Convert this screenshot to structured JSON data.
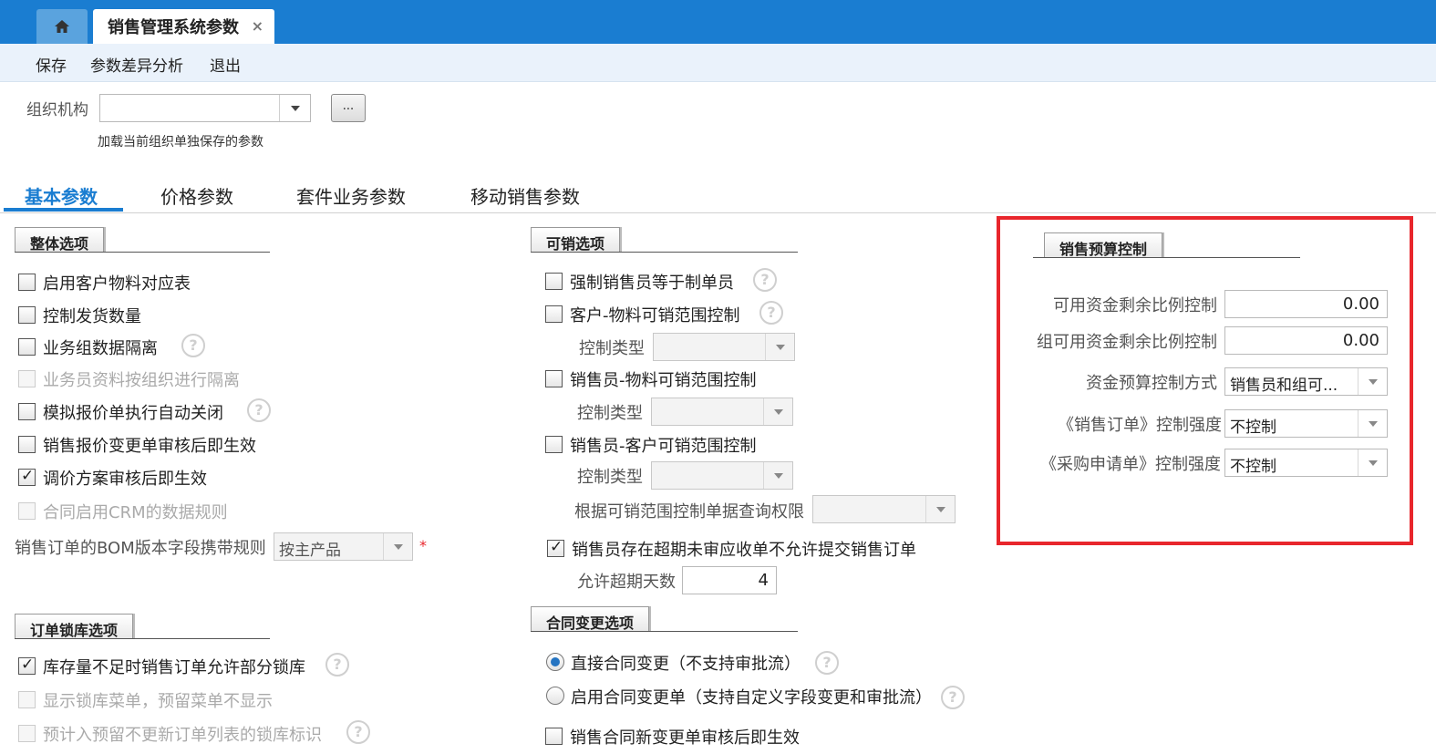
{
  "window": {
    "tab_title": "销售管理系统参数",
    "close_glyph": "×"
  },
  "toolbar": {
    "save": "保存",
    "diff_analysis": "参数差异分析",
    "exit": "退出"
  },
  "org": {
    "label": "组织机构",
    "value": "",
    "browse": "...",
    "hint": "加载当前组织单独保存的参数"
  },
  "tabs": [
    "基本参数",
    "价格参数",
    "套件业务参数",
    "移动销售参数"
  ],
  "overall": {
    "header": "整体选项",
    "items": [
      {
        "label": "启用客户物料对应表",
        "checked": false,
        "disabled": false
      },
      {
        "label": "控制发货数量",
        "checked": false,
        "disabled": false
      },
      {
        "label": "业务组数据隔离",
        "checked": false,
        "disabled": false
      },
      {
        "label": "业务员资料按组织进行隔离",
        "checked": false,
        "disabled": true
      },
      {
        "label": "模拟报价单执行自动关闭",
        "checked": false,
        "disabled": false
      },
      {
        "label": "销售报价变更单审核后即生效",
        "checked": false,
        "disabled": false
      },
      {
        "label": "调价方案审核后即生效",
        "checked": true,
        "disabled": false
      },
      {
        "label": "合同启用CRM的数据规则",
        "checked": false,
        "disabled": true
      }
    ],
    "bom_label": "销售订单的BOM版本字段携带规则",
    "bom_value": "按主产品",
    "required_mark": "*"
  },
  "lock": {
    "header": "订单锁库选项",
    "items": [
      {
        "label": "库存量不足时销售订单允许部分锁库",
        "checked": true,
        "disabled": false
      },
      {
        "label": "显示锁库菜单，预留菜单不显示",
        "checked": false,
        "disabled": true
      },
      {
        "label": "预计入预留不更新订单列表的锁库标识",
        "checked": false,
        "disabled": true
      }
    ]
  },
  "salable": {
    "header": "可销选项",
    "items": [
      {
        "label": "强制销售员等于制单员",
        "checked": false
      },
      {
        "label": "客户-物料可销范围控制",
        "checked": false
      },
      {
        "label": "销售员-物料可销范围控制",
        "checked": false
      },
      {
        "label": "销售员-客户可销范围控制",
        "checked": false
      }
    ],
    "control_type_label": "控制类型",
    "query_perm_label": "根据可销范围控制单据查询权限",
    "overdue_label": "销售员存在超期未审应收单不允许提交销售订单",
    "overdue_checked": true,
    "overdue_days_label": "允许超期天数",
    "overdue_days_value": "4"
  },
  "contract": {
    "header": "合同变更选项",
    "direct_label": "直接合同变更（不支持审批流）",
    "enable_label": "启用合同变更单（支持自定义字段变更和审批流）",
    "effective_label": "销售合同新变更单审核后即生效",
    "selected": "direct"
  },
  "budget": {
    "header": "销售预算控制",
    "rows": [
      {
        "label": "可用资金剩余比例控制",
        "value": "0.00"
      },
      {
        "label": "组可用资金剩余比例控制",
        "value": "0.00"
      },
      {
        "label": "资金预算控制方式",
        "value": "销售员和组可..."
      },
      {
        "label": "《销售订单》控制强度",
        "value": "不控制"
      },
      {
        "label": "《采购申请单》控制强度",
        "value": "不控制"
      }
    ],
    "highlight_color": "#e8262c"
  },
  "help_glyph": "?",
  "check_glyph": "✓",
  "colors": {
    "brand": "#1a7dd1",
    "highlight": "#e8262c"
  }
}
